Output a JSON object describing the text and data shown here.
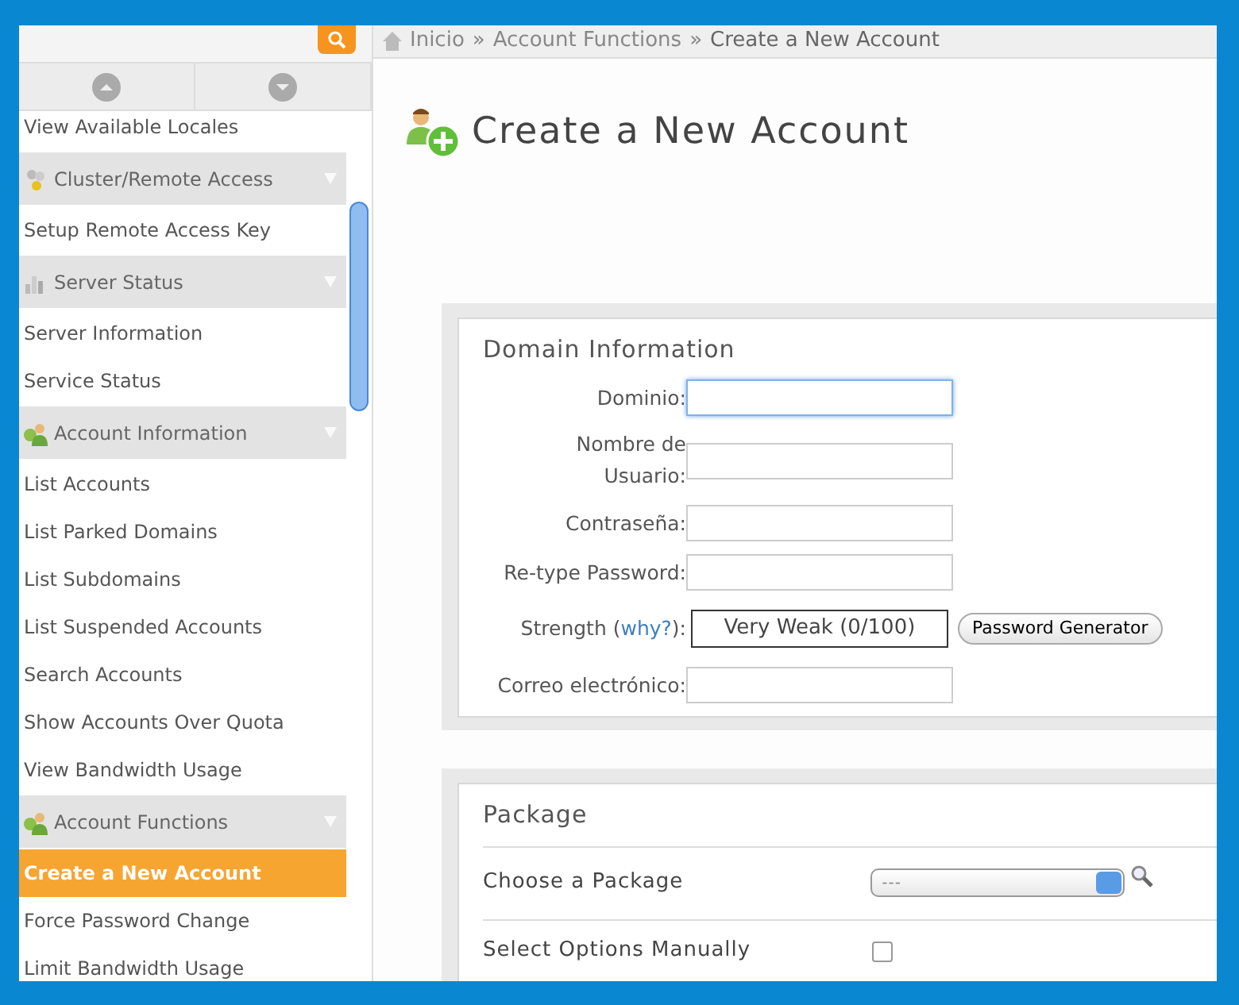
{
  "sidebar": {
    "items": [
      {
        "kind": "link",
        "label": "View Available Locales",
        "selected": false
      },
      {
        "kind": "header",
        "label": "Cluster/Remote Access"
      },
      {
        "kind": "link",
        "label": "Setup Remote Access Key",
        "selected": false
      },
      {
        "kind": "header",
        "label": "Server Status"
      },
      {
        "kind": "link",
        "label": "Server Information",
        "selected": false
      },
      {
        "kind": "link",
        "label": "Service Status",
        "selected": false
      },
      {
        "kind": "header",
        "label": "Account Information"
      },
      {
        "kind": "link",
        "label": "List Accounts",
        "selected": false
      },
      {
        "kind": "link",
        "label": "List Parked Domains",
        "selected": false
      },
      {
        "kind": "link",
        "label": "List Subdomains",
        "selected": false
      },
      {
        "kind": "link",
        "label": "List Suspended Accounts",
        "selected": false
      },
      {
        "kind": "link",
        "label": "Search Accounts",
        "selected": false
      },
      {
        "kind": "link",
        "label": "Show Accounts Over Quota",
        "selected": false
      },
      {
        "kind": "link",
        "label": "View Bandwidth Usage",
        "selected": false
      },
      {
        "kind": "header",
        "label": "Account Functions"
      },
      {
        "kind": "link",
        "label": "Create a New Account",
        "selected": true
      },
      {
        "kind": "link",
        "label": "Force Password Change",
        "selected": false
      },
      {
        "kind": "link",
        "label": "Limit Bandwidth Usage",
        "selected": false
      }
    ]
  },
  "breadcrumb": {
    "separator": "»",
    "items": [
      {
        "label": "Inicio"
      },
      {
        "label": "Account Functions"
      },
      {
        "label": "Create a New Account"
      }
    ]
  },
  "page_title": "Create a New Account",
  "domain_information": {
    "title": "Domain Information",
    "fields": [
      {
        "label": "Dominio:",
        "focused": true
      },
      {
        "label": "Nombre de\nUsuario:",
        "focused": false
      },
      {
        "label": "Contraseña:",
        "focused": false
      },
      {
        "label": "Re-type Password:",
        "focused": false
      }
    ],
    "strength": {
      "label_before": "Strength (",
      "link": "why?",
      "label_after": "):",
      "meter": "Very Weak (0/100)",
      "button": "Password Generator"
    },
    "email_field": {
      "label": "Correo electrónico:",
      "focused": false
    }
  },
  "package": {
    "title": "Package",
    "choose_label": "Choose a Package",
    "select_value": "---",
    "manual_label": "Select Options Manually",
    "manual_checked": false
  }
}
